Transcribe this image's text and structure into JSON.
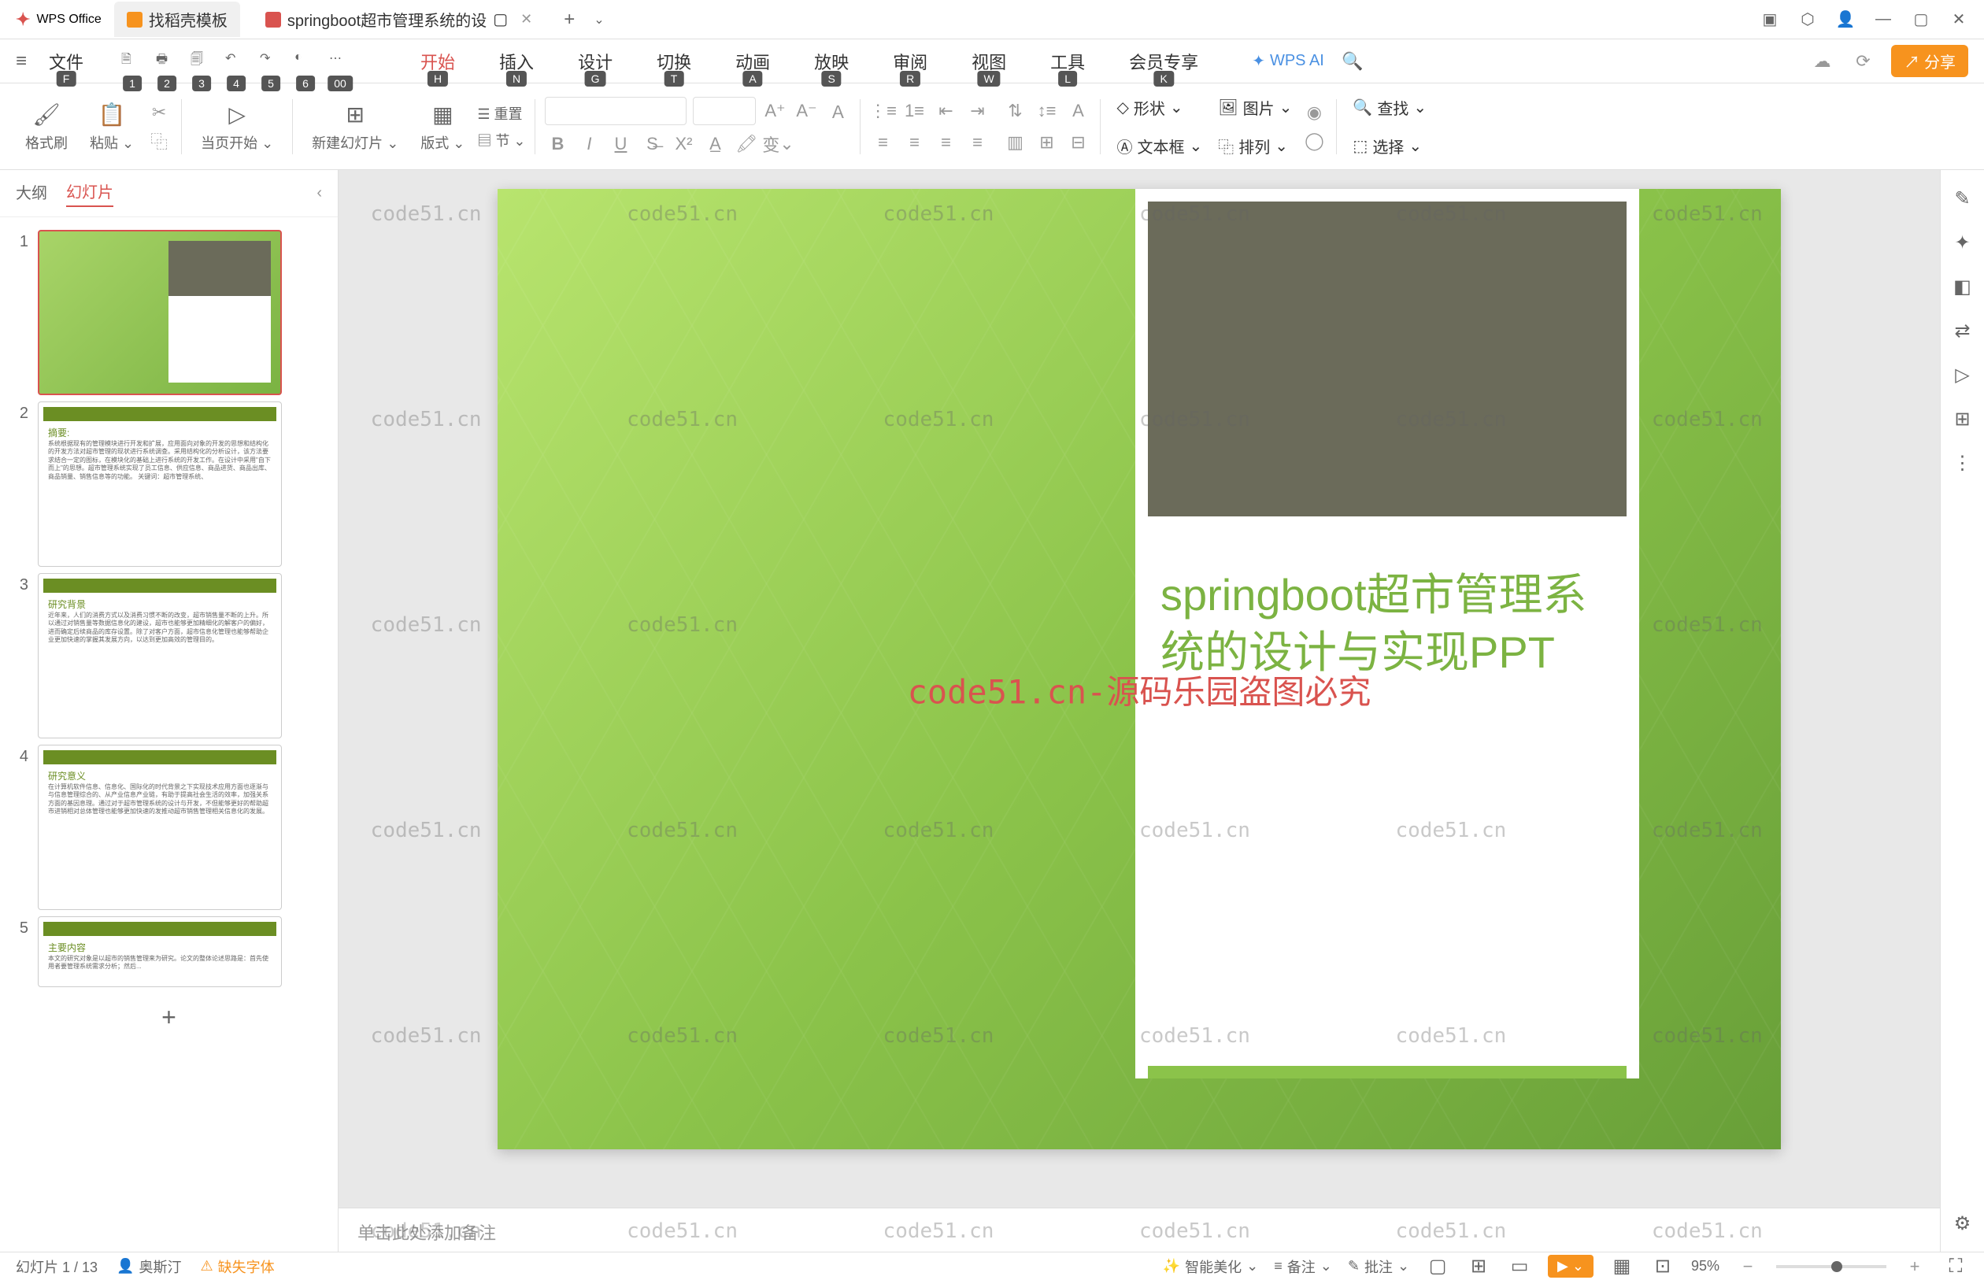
{
  "titlebar": {
    "app_name": "WPS Office",
    "tabs": [
      {
        "label": "找稻壳模板",
        "icon_color": "orange"
      },
      {
        "label": "springboot超市管理系统的设",
        "icon_color": "red",
        "active": true
      }
    ]
  },
  "menubar": {
    "file_label": "文件",
    "file_hint": "F",
    "shortcuts": [
      {
        "hint": "1"
      },
      {
        "hint": "2"
      },
      {
        "hint": "3"
      },
      {
        "hint": "4"
      },
      {
        "hint": "5"
      },
      {
        "hint": "6"
      },
      {
        "hint": "00"
      }
    ],
    "tabs": [
      {
        "label": "开始",
        "hint": "H",
        "active": true
      },
      {
        "label": "插入",
        "hint": "N"
      },
      {
        "label": "设计",
        "hint": "G"
      },
      {
        "label": "切换",
        "hint": "T"
      },
      {
        "label": "动画",
        "hint": "A"
      },
      {
        "label": "放映",
        "hint": "S"
      },
      {
        "label": "审阅",
        "hint": "R"
      },
      {
        "label": "视图",
        "hint": "W"
      },
      {
        "label": "工具",
        "hint": "L"
      },
      {
        "label": "会员专享",
        "hint": "K"
      }
    ],
    "wps_ai": "WPS AI",
    "share_label": "分享"
  },
  "ribbon": {
    "format_painter": "格式刷",
    "paste": "粘贴",
    "start_current": "当页开始",
    "new_slide": "新建幻灯片",
    "layout": "版式",
    "section": "节",
    "reset": "重置",
    "shape": "形状",
    "image": "图片",
    "textbox": "文本框",
    "arrange": "排列",
    "find": "查找",
    "select": "选择",
    "font_name": "",
    "font_size": "",
    "ruby": "变"
  },
  "sidebar": {
    "outline_tab": "大纲",
    "slides_tab": "幻灯片",
    "slides": [
      {
        "num": "1",
        "type": "title"
      },
      {
        "num": "2",
        "title": "摘要:",
        "body": "系统根据现有的管理模块进行开发和扩展，应用面向对象的开发的思想和结构化的开发方法对超市管理的现状进行系统调查。采用结构化的分析设计，该方法要求结合一定的图标，在模块化的基础上进行系统的开发工作。在设计中采用\"自下而上\"的思想。超市管理系统实现了员工信息、供应信息、商品进货、商品出库、商品销量、销售信息等的功能。\n关键词：超市管理系统、"
      },
      {
        "num": "3",
        "title": "研究背景",
        "body": "近年来，人们的消费方式以及消费习惯不断的改变，超市销售量不断的上升。所以通过对销售量等数据信息化的建设，超市也能够更加精细化的解客户的偏好，进而确定后续商品的库存设置。除了对客户方面，超市信息化管理也能够帮助企业更加快速的掌握其发展方向，以达到更加高效的管理目的。"
      },
      {
        "num": "4",
        "title": "研究意义",
        "body": "在计算机软件信息、信息化、国际化的时代背景之下实现技术应用方面也逐渐与与信息管理综合的、从产业信息产业链，有助于提高社会生活的效率，加强关系方面的基因息理。通过对于超市管理系统的设计与开发，不但能够更好的帮助超市进销相对总体管理也能够更加快速的发推动超市销售管理相关信息化的发展。"
      },
      {
        "num": "5",
        "title": "主要内容",
        "body": "本文的研究对象是以超市的销售管理来为研究。论文的整体论述思路是：首先使用者要管理系统需求分析；然后..."
      }
    ]
  },
  "canvas": {
    "title_text": "springboot超市管理系统的设计与实现PPT",
    "watermark_center": "code51.cn-源码乐园盗图必究",
    "watermark_text": "code51.cn"
  },
  "notes": {
    "placeholder": "单击此处添加备注"
  },
  "statusbar": {
    "slide_count": "幻灯片 1 / 13",
    "author": "奥斯汀",
    "missing_font": "缺失字体",
    "smart_beautify": "智能美化",
    "notes": "备注",
    "comments": "批注",
    "zoom": "95%"
  }
}
